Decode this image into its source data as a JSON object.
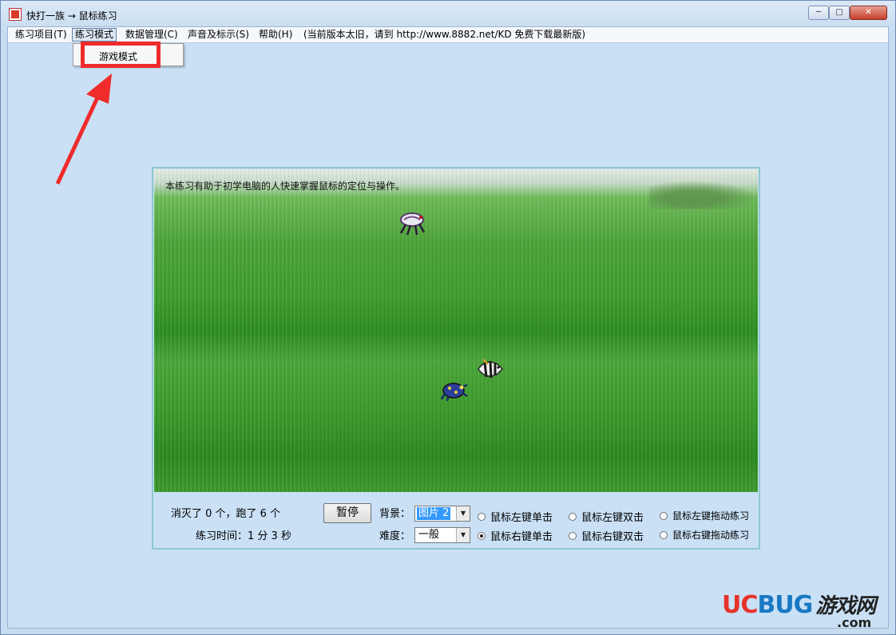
{
  "window": {
    "title": "快打一族 → 鼠标练习",
    "controls": {
      "min": "─",
      "max": "□",
      "close": "✕"
    }
  },
  "menu": {
    "items": [
      "练习项目(T)",
      "练习模式",
      "数据管理(C)",
      "声音及标示(S)",
      "帮助(H)",
      "(当前版本太旧，请到 http://www.8882.net/KD 免费下载最新版)"
    ],
    "open_menu": "练习模式",
    "dropdown_items": [
      "游戏模式"
    ]
  },
  "game": {
    "hint": "本练习有助于初学电脑的人快速掌握鼠标的定位与操作。",
    "sprites": [
      "crab-sprite",
      "fish-sprite",
      "frog-sprite"
    ]
  },
  "controls": {
    "score_text": "消灭了 0 个，跑了 6 个",
    "time_text": "练习时间：1 分 3 秒",
    "pause_label": "暂停",
    "background_label": "背景：",
    "background_value": "图片 2",
    "difficulty_label": "难度：",
    "difficulty_value": "一般",
    "radios": [
      {
        "label": "鼠标左键单击",
        "checked": false
      },
      {
        "label": "鼠标左键双击",
        "checked": false
      },
      {
        "label": "鼠标左键拖动练习",
        "checked": false
      },
      {
        "label": "鼠标右键单击",
        "checked": true
      },
      {
        "label": "鼠标右键双击",
        "checked": false
      },
      {
        "label": "鼠标右键拖动练习",
        "checked": false
      }
    ]
  },
  "watermark": {
    "uc": "UC",
    "bug": "BUG",
    "cn": "游戏网",
    "com": ".com"
  },
  "colors": {
    "highlight": "#ef2b2b",
    "panel_border": "#8ec7cc",
    "field": "#3f9d2c"
  }
}
